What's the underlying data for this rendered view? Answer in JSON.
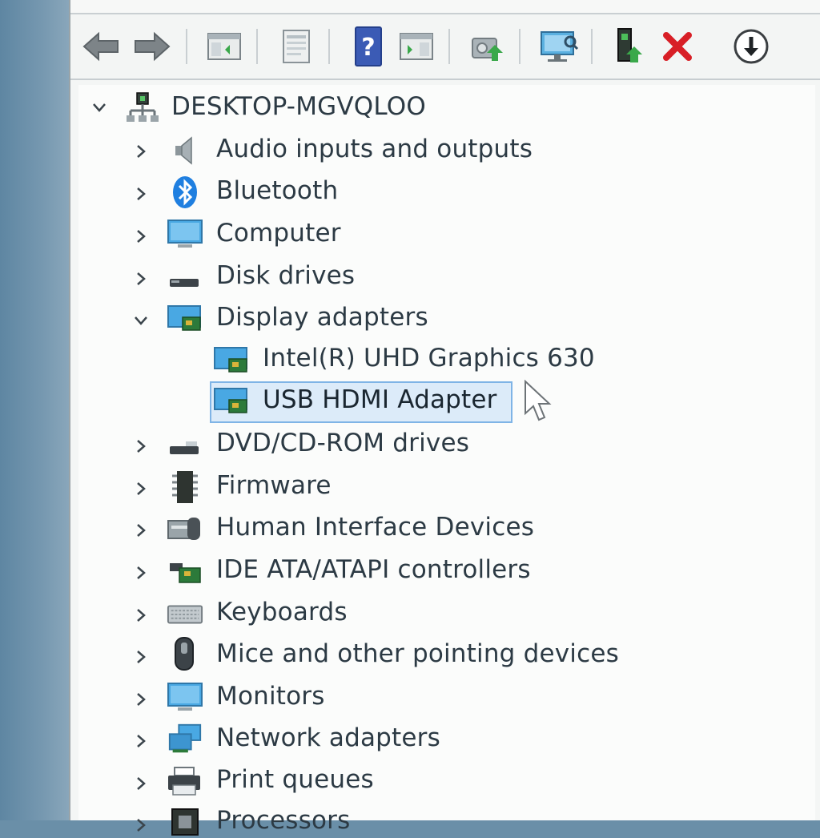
{
  "colors": {
    "window_bg": "#f4f6f5",
    "tree_bg": "#fbfcfb",
    "text": "#2c3a44",
    "selection_bg": "#dcebf9",
    "selection_border": "#7fb4e6",
    "delete_red": "#d81f26",
    "help_blue": "#3b5bb5"
  },
  "toolbar": {
    "buttons": [
      {
        "icon": "back-arrow-icon"
      },
      {
        "icon": "forward-arrow-icon"
      },
      {
        "icon": "show-hide-console-tree-icon"
      },
      {
        "icon": "properties-icon"
      },
      {
        "icon": "help-icon"
      },
      {
        "icon": "action-pane-icon"
      },
      {
        "icon": "update-driver-icon"
      },
      {
        "icon": "scan-hardware-icon"
      },
      {
        "icon": "enable-device-icon"
      },
      {
        "icon": "uninstall-device-icon"
      },
      {
        "icon": "download-icon"
      }
    ]
  },
  "tree": {
    "root": {
      "label": "DESKTOP-MGVQLOO",
      "icon": "computer-network-icon",
      "expanded": true
    },
    "categories": [
      {
        "label": "Audio inputs and outputs",
        "icon": "speaker-icon",
        "expanded": false
      },
      {
        "label": "Bluetooth",
        "icon": "bluetooth-icon",
        "expanded": false
      },
      {
        "label": "Computer",
        "icon": "monitor-icon",
        "expanded": false
      },
      {
        "label": "Disk drives",
        "icon": "disk-drive-icon",
        "expanded": false
      },
      {
        "label": "Display adapters",
        "icon": "display-adapter-icon",
        "expanded": true,
        "children": [
          {
            "label": "Intel(R) UHD Graphics 630",
            "icon": "display-adapter-icon",
            "selected": false
          },
          {
            "label": "USB HDMI  Adapter",
            "icon": "display-adapter-icon",
            "selected": true
          }
        ]
      },
      {
        "label": "DVD/CD-ROM drives",
        "icon": "dvd-drive-icon",
        "expanded": false
      },
      {
        "label": "Firmware",
        "icon": "firmware-chip-icon",
        "expanded": false
      },
      {
        "label": "Human Interface Devices",
        "icon": "hid-icon",
        "expanded": false
      },
      {
        "label": "IDE ATA/ATAPI controllers",
        "icon": "ide-controller-icon",
        "expanded": false
      },
      {
        "label": "Keyboards",
        "icon": "keyboard-icon",
        "expanded": false
      },
      {
        "label": "Mice and other pointing devices",
        "icon": "mouse-icon",
        "expanded": false
      },
      {
        "label": "Monitors",
        "icon": "monitor-icon",
        "expanded": false
      },
      {
        "label": "Network adapters",
        "icon": "network-adapter-icon",
        "expanded": false
      },
      {
        "label": "Print queues",
        "icon": "printer-icon",
        "expanded": false
      },
      {
        "label": "Processors",
        "icon": "processor-icon",
        "expanded": false
      }
    ]
  }
}
